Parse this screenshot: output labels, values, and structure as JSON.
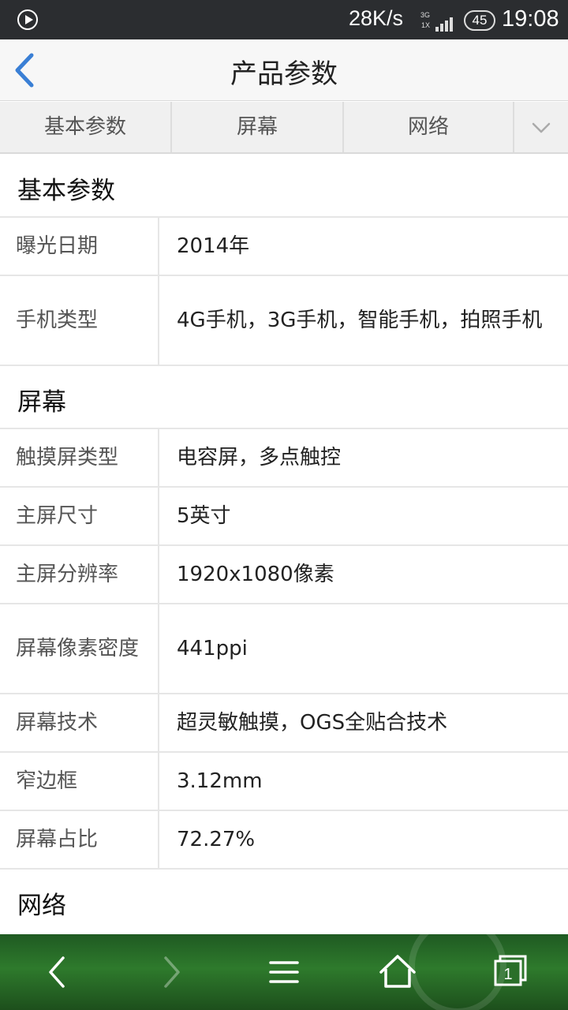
{
  "status_bar": {
    "net_speed": "28K/s",
    "signal_top": "3G",
    "signal_bottom": "1X",
    "battery": "45",
    "time": "19:08"
  },
  "header": {
    "title": "产品参数"
  },
  "tabs": [
    "基本参数",
    "屏幕",
    "网络"
  ],
  "sections": {
    "basic": {
      "title": "基本参数",
      "rows": [
        {
          "key": "曝光日期",
          "value": "2014年"
        },
        {
          "key": "手机类型",
          "value": "4G手机，3G手机，智能手机，拍照手机"
        }
      ]
    },
    "screen": {
      "title": "屏幕",
      "rows": [
        {
          "key": "触摸屏类型",
          "value": "电容屏，多点触控"
        },
        {
          "key": "主屏尺寸",
          "value": "5英寸"
        },
        {
          "key": "主屏分辨率",
          "value": "1920x1080像素"
        },
        {
          "key": "屏幕像素密度",
          "value": "441ppi"
        },
        {
          "key": "屏幕技术",
          "value": "超灵敏触摸，OGS全贴合技术"
        },
        {
          "key": "窄边框",
          "value": "3.12mm"
        },
        {
          "key": "屏幕占比",
          "value": "72.27%"
        }
      ]
    },
    "network": {
      "title": "网络"
    }
  },
  "toolbar": {
    "tab_count": "1"
  },
  "colors": {
    "accent_blue": "#3a7fd5",
    "toolbar_green": "#2e7a2c"
  }
}
